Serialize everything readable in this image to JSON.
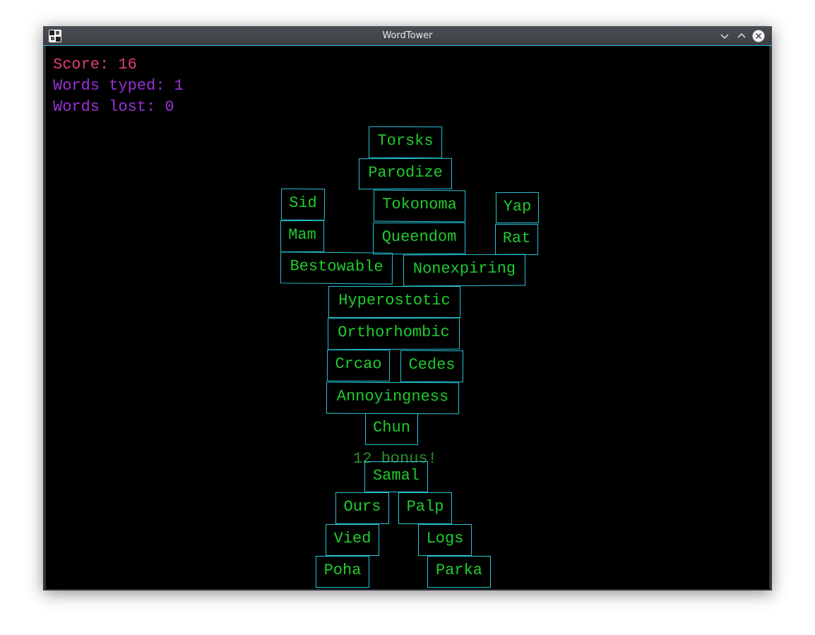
{
  "window": {
    "title": "WordTower"
  },
  "stats": {
    "score": "Score: 16",
    "words_typed": "Words typed: 1",
    "words_lost": "Words lost: 0"
  },
  "bonus_text": "12 bonus!",
  "blocks": [
    "Torsks",
    "Parodize",
    "Sid",
    "Tokonoma",
    "Yap",
    "Mam",
    "Queendom",
    "Rat",
    "Bestowable",
    "Nonexpiring",
    "Hyperostotic",
    "Orthorhombic",
    "Crcao",
    "Cedes",
    "Annoyingness",
    "Chun",
    "Samal",
    "Ours",
    "Palp",
    "Vied",
    "Logs",
    "Poha",
    "Parka"
  ],
  "colors": {
    "score": "#e0406a",
    "stats": "#9b30d9",
    "word": "#1fcc2e",
    "block_border": "#27c4d6",
    "bonus": "#2a8f2a",
    "background": "#000000"
  },
  "icons": [
    "app-icon",
    "minimize-icon",
    "maximize-icon",
    "close-icon"
  ]
}
